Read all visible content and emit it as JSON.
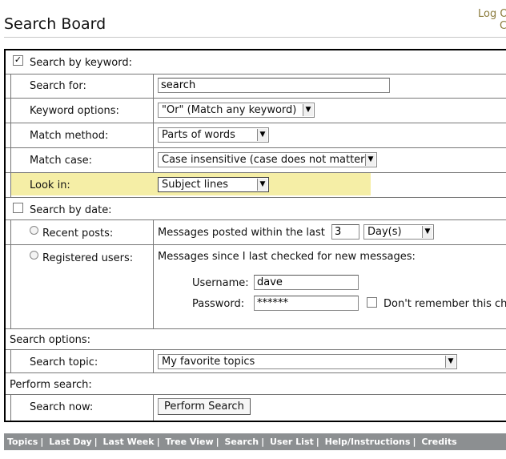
{
  "header": {
    "title": "Search Board",
    "logout_line1": "Log O",
    "logout_line2": "C"
  },
  "keyword_section": {
    "checkbox_label": "Search by keyword:",
    "checked": true,
    "search_for_label": "Search for:",
    "search_for_value": "search",
    "keyword_options_label": "Keyword options:",
    "keyword_options_value": "\"Or\" (Match any keyword)",
    "match_method_label": "Match method:",
    "match_method_value": "Parts of words",
    "match_case_label": "Match case:",
    "match_case_value": "Case insensitive (case does not matter)",
    "look_in_label": "Look in:",
    "look_in_value": "Subject lines",
    "highlight_color": "#f5eea6"
  },
  "date_section": {
    "checkbox_label": "Search by date:",
    "checked": false,
    "recent_posts_label": "Recent posts:",
    "recent_posts_text": "Messages posted within the last",
    "recent_posts_count": "3",
    "recent_posts_unit": "Day(s)",
    "registered_users_label": "Registered users:",
    "registered_users_text": "Messages since I last checked for new messages:",
    "username_label": "Username:",
    "username_value": "dave",
    "password_label": "Password:",
    "password_value": "******",
    "dont_remember_label": "Don't remember this ch"
  },
  "options_section": {
    "heading": "Search options:",
    "search_topic_label": "Search topic:",
    "search_topic_value": "My favorite topics"
  },
  "perform_section": {
    "heading": "Perform search:",
    "search_now_label": "Search now:",
    "button_label": "Perform Search"
  },
  "footer": {
    "links": [
      "Topics",
      "Last Day",
      "Last Week",
      "Tree View",
      "Search",
      "User List",
      "Help/Instructions",
      "Credits"
    ],
    "bar_color": "#8c8f91"
  },
  "icons": {
    "checkmark": "checkmark-icon",
    "dropdown_arrow": "chevron-down-icon"
  }
}
